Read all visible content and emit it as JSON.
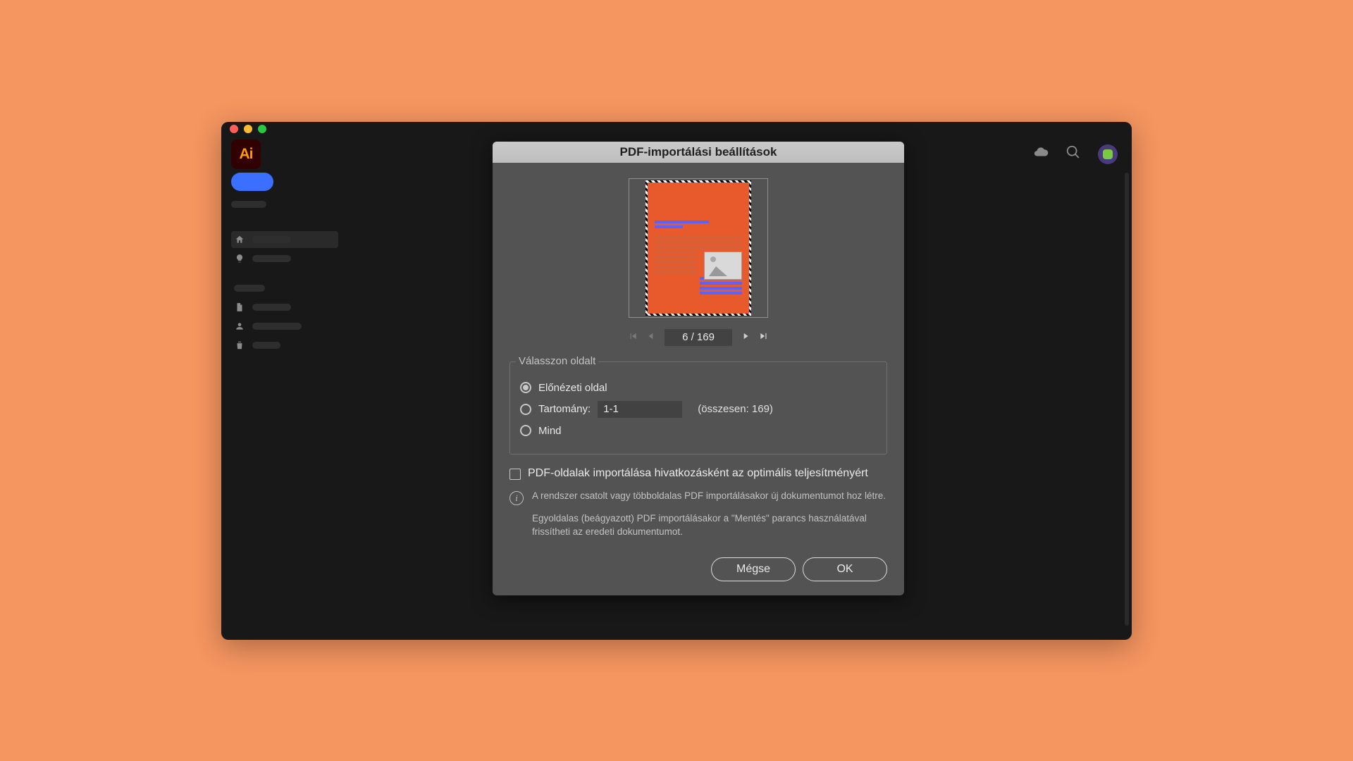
{
  "app": {
    "iconText": "Ai"
  },
  "dialog": {
    "title": "PDF-importálási beállítások",
    "pager": {
      "current": "6",
      "total": "169",
      "display": "6 / 169"
    },
    "selectPage": {
      "legend": "Válasszon oldalt",
      "opt_preview": "Előnézeti oldal",
      "opt_range": "Tartomány:",
      "range_value": "1-1",
      "total_label": "(összesen: 169)",
      "opt_all": "Mind",
      "selected": "preview"
    },
    "checkbox_label": "PDF-oldalak importálása hivatkozásként az optimális teljesítményért",
    "info1": "A rendszer csatolt vagy többoldalas PDF importálásakor új dokumentumot hoz létre.",
    "info2": "Egyoldalas (beágyazott) PDF importálásakor a \"Mentés\" parancs használatával frissítheti az eredeti dokumentumot.",
    "btn_cancel": "Mégse",
    "btn_ok": "OK"
  }
}
